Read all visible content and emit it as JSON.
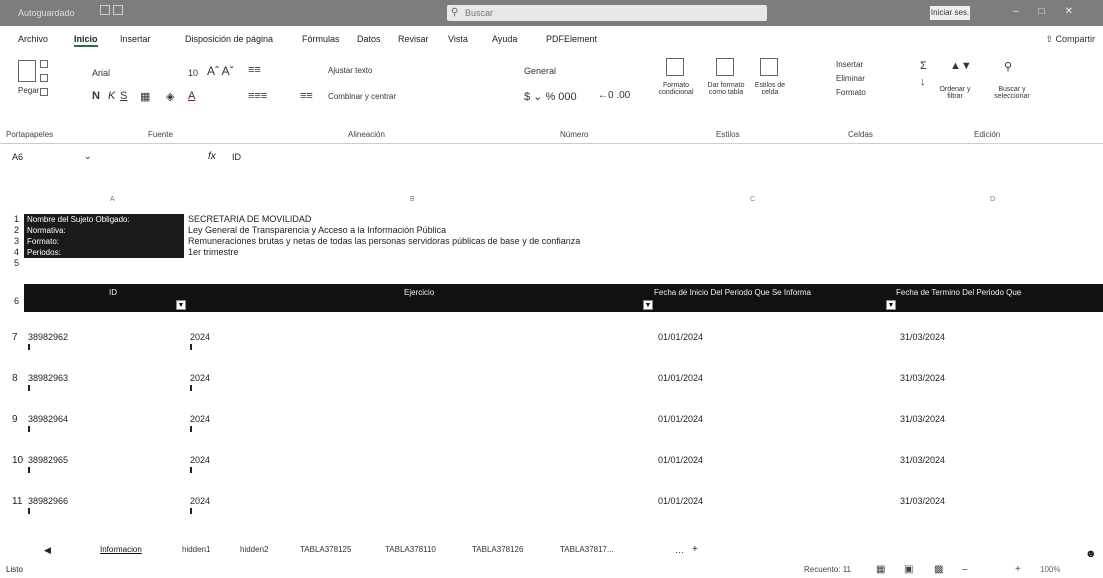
{
  "titlebar": {
    "autosave": "Autoguardado",
    "doc_title": "",
    "search_placeholder": "Buscar",
    "signin": "Iniciar ses."
  },
  "menu": {
    "tabs": [
      "Archivo",
      "Inicio",
      "Insertar",
      "Disposición de página",
      "Fórmulas",
      "Datos",
      "Revisar",
      "Vista",
      "Ayuda",
      "PDFElement"
    ],
    "active": "Inicio",
    "share": "Compartir"
  },
  "ribbon": {
    "paste": "Pegar",
    "font_name": "Arial",
    "font_size": "10",
    "wrap_text": "Ajustar texto",
    "merge_center": "Combinar y centrar",
    "number_format": "General",
    "conditional_format": "Formato condicional",
    "format_as_table": "Dar formato como tabla",
    "cell_styles": "Estilos de celda",
    "insert": "Insertar",
    "delete": "Eliminar",
    "format": "Formato",
    "sort_filter": "Ordenar y filtrar",
    "find_select": "Buscar y seleccionar",
    "groups": [
      "Portapapeles",
      "Fuente",
      "Alineación",
      "Número",
      "Estilos",
      "Celdas",
      "Edición"
    ]
  },
  "formula_bar": {
    "name_box": "A6",
    "fx": "fx",
    "value": "ID"
  },
  "sheet": {
    "meta": [
      {
        "row": "1",
        "label": "Nombre del Sujeto Obligado:",
        "value": "SECRETARIA DE MOVILIDAD"
      },
      {
        "row": "2",
        "label": "Normativa:",
        "value": "Ley General de Transparencia y Acceso a la Información Pública"
      },
      {
        "row": "3",
        "label": "Formato:",
        "value": "Remuneraciones brutas y netas de todas las personas servidoras públicas de base y de confianza"
      },
      {
        "row": "4",
        "label": "Periodos:",
        "value": "1er trimestre"
      }
    ],
    "row5": "5",
    "header_row": "6",
    "headers": [
      "ID",
      "Ejercicio",
      "Fecha de Inicio Del Periodo Que Se Informa",
      "Fecha de Termino Del Periodo Que"
    ],
    "rows": [
      {
        "row": "7",
        "id": "38982962",
        "ejercicio": "2024",
        "inicio": "01/01/2024",
        "termino": "31/03/2024"
      },
      {
        "row": "8",
        "id": "38982963",
        "ejercicio": "2024",
        "inicio": "01/01/2024",
        "termino": "31/03/2024"
      },
      {
        "row": "9",
        "id": "38982964",
        "ejercicio": "2024",
        "inicio": "01/01/2024",
        "termino": "31/03/2024"
      },
      {
        "row": "10",
        "id": "38982965",
        "ejercicio": "2024",
        "inicio": "01/01/2024",
        "termino": "31/03/2024"
      },
      {
        "row": "11",
        "id": "38982966",
        "ejercicio": "2024",
        "inicio": "01/01/2024",
        "termino": "31/03/2024"
      }
    ]
  },
  "sheet_tabs": {
    "tabs": [
      "Informacion",
      "hidden1",
      "hidden2",
      "TABLA378125",
      "TABLA378110",
      "TABLA378126",
      "TABLA37817..."
    ],
    "active": "Informacion"
  },
  "status": {
    "ready": "Listo",
    "count": "Recuento: 11",
    "zoom": "100%"
  }
}
